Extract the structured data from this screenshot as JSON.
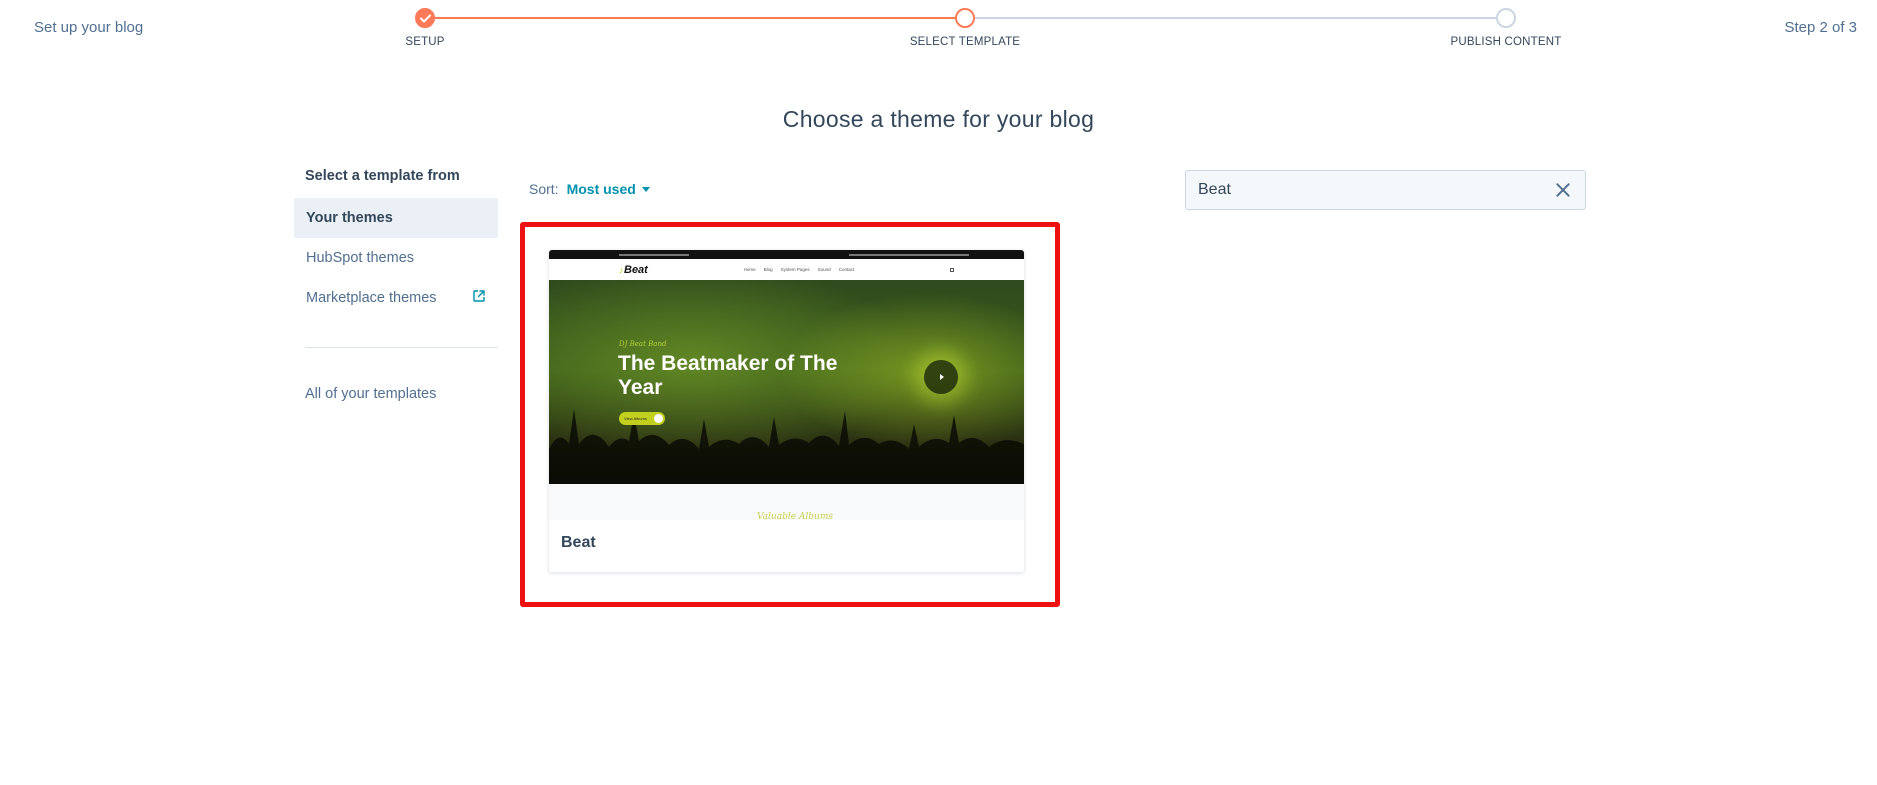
{
  "header": {
    "setup_title": "Set up your blog",
    "step_count": "Step 2 of 3",
    "steps": [
      {
        "label": "SETUP",
        "state": "done"
      },
      {
        "label": "SELECT TEMPLATE",
        "state": "current"
      },
      {
        "label": "PUBLISH CONTENT",
        "state": "todo"
      }
    ]
  },
  "main": {
    "title": "Choose a theme for your blog"
  },
  "sidebar": {
    "heading": "Select a template from",
    "items": [
      {
        "label": "Your themes",
        "active": true
      },
      {
        "label": "HubSpot themes",
        "active": false
      },
      {
        "label": "Marketplace themes",
        "active": false,
        "icon": "external-link-icon"
      }
    ],
    "all_templates": "All of your templates"
  },
  "sort": {
    "label": "Sort:",
    "value": "Most used"
  },
  "search": {
    "value": "Beat"
  },
  "results": [
    {
      "name": "Beat",
      "preview": {
        "logo": "Beat",
        "menu": [
          "Home",
          "Blog",
          "System Pages",
          "Sound",
          "Contact"
        ],
        "script": "DJ Beat Band",
        "headline": "The Beatmaker of The Year",
        "button": "View Albums",
        "below_script": "Valuable Albums"
      }
    }
  ],
  "colors": {
    "accent": "#ff7a59",
    "link": "#0091ae",
    "highlight": "#ee1111",
    "text": "#33475b"
  }
}
